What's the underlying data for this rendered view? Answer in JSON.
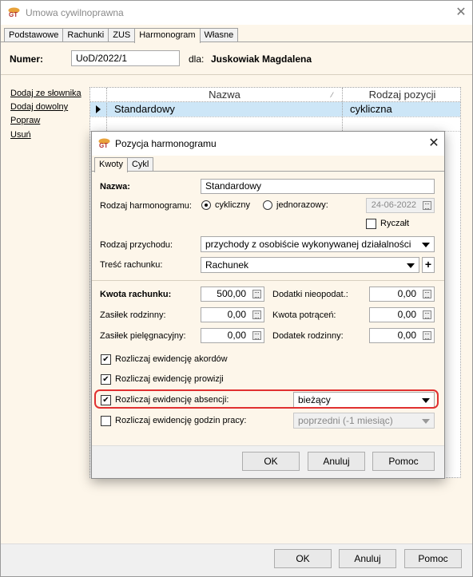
{
  "window": {
    "title": "Umowa cywilnoprawna",
    "tabs": [
      "Podstawowe",
      "Rachunki",
      "ZUS",
      "Harmonogram",
      "Własne"
    ],
    "active_tab": "Harmonogram"
  },
  "header": {
    "numer_label": "Numer:",
    "numer_value": "UoD/2022/1",
    "dla_label": "dla:",
    "dla_value": "Juskowiak Magdalena"
  },
  "sidebar": {
    "links": [
      "Dodaj ze słownika",
      "Dodaj dowolny",
      "Popraw",
      "Usuń"
    ]
  },
  "grid": {
    "columns": [
      "Nazwa",
      "Rodzaj pozycji"
    ],
    "rows": [
      {
        "nazwa": "Standardowy",
        "rodzaj": "cykliczna"
      }
    ]
  },
  "footer": {
    "ok": "OK",
    "cancel": "Anuluj",
    "help": "Pomoc"
  },
  "dialog": {
    "title": "Pozycja harmonogramu",
    "tabs": [
      "Kwoty",
      "Cykl"
    ],
    "active_tab": "Kwoty",
    "nazwa_label": "Nazwa:",
    "nazwa_value": "Standardowy",
    "rodzaj_label": "Rodzaj harmonogramu:",
    "radio_cykliczny": "cykliczny",
    "radio_jednorazowy": "jednorazowy:",
    "date_value": "24-06-2022",
    "ryczalt_label": "Ryczałt",
    "przychod_label": "Rodzaj przychodu:",
    "przychod_value": "przychody z osobiście wykonywanej działalności",
    "tresc_label": "Treść rachunku:",
    "tresc_value": "Rachunek",
    "plus": "+",
    "kwota_label": "Kwota rachunku:",
    "kwota_value": "500,00",
    "dodatki_label": "Dodatki nieopodat.:",
    "dodatki_value": "0,00",
    "zasilek_rodz_label": "Zasiłek rodzinny:",
    "zasilek_rodz_value": "0,00",
    "potracen_label": "Kwota potrąceń:",
    "potracen_value": "0,00",
    "zasilek_piel_label": "Zasiłek pielęgnacyjny:",
    "zasilek_piel_value": "0,00",
    "dodatek_rodz_label": "Dodatek rodzinny:",
    "dodatek_rodz_value": "0,00",
    "chk_akordow": "Rozliczaj ewidencję akordów",
    "chk_prowizji": "Rozliczaj ewidencję prowizji",
    "chk_absencji": "Rozliczaj ewidencję absencji:",
    "absencji_value": "bieżący",
    "chk_godzin": "Rozliczaj ewidencję godzin pracy:",
    "godzin_value": "poprzedni (-1 miesiąc)",
    "ok": "OK",
    "cancel": "Anuluj",
    "help": "Pomoc"
  },
  "colors": {
    "window_bg": "#fdf6ea",
    "selected_row": "#cde6f7",
    "highlight": "#e03030"
  }
}
